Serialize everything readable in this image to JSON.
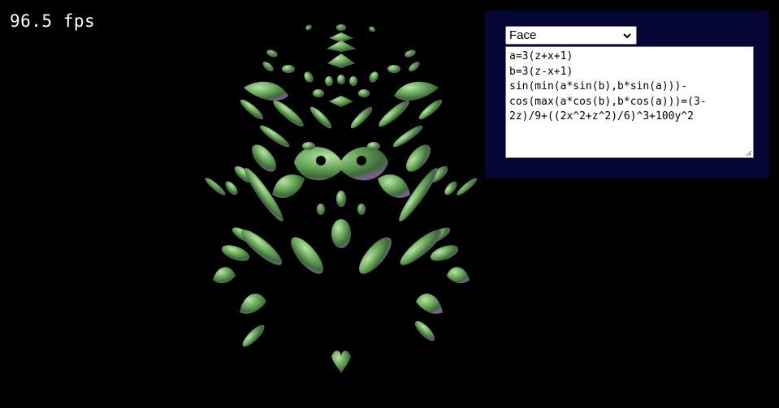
{
  "fps": {
    "text": "96.5 fps"
  },
  "controls": {
    "preset_selected": "Face",
    "equation": "a=3(z+x+1)\nb=3(z-x+1)\nsin(min(a*sin(b),b*sin(a)))-\ncos(max(a*cos(b),b*cos(a)))=(3-\n2z)/9+((2x^2+z^2)/6)^3+100y^2"
  },
  "colors": {
    "background": "#000000",
    "panel": "#050636",
    "surface_base": "#5f9e55",
    "surface_highlight": "#a6d994",
    "surface_tint": "#8a6fa0"
  },
  "icons": {
    "dropdown": "chevron-down-icon",
    "resize": "resize-grip-icon"
  }
}
